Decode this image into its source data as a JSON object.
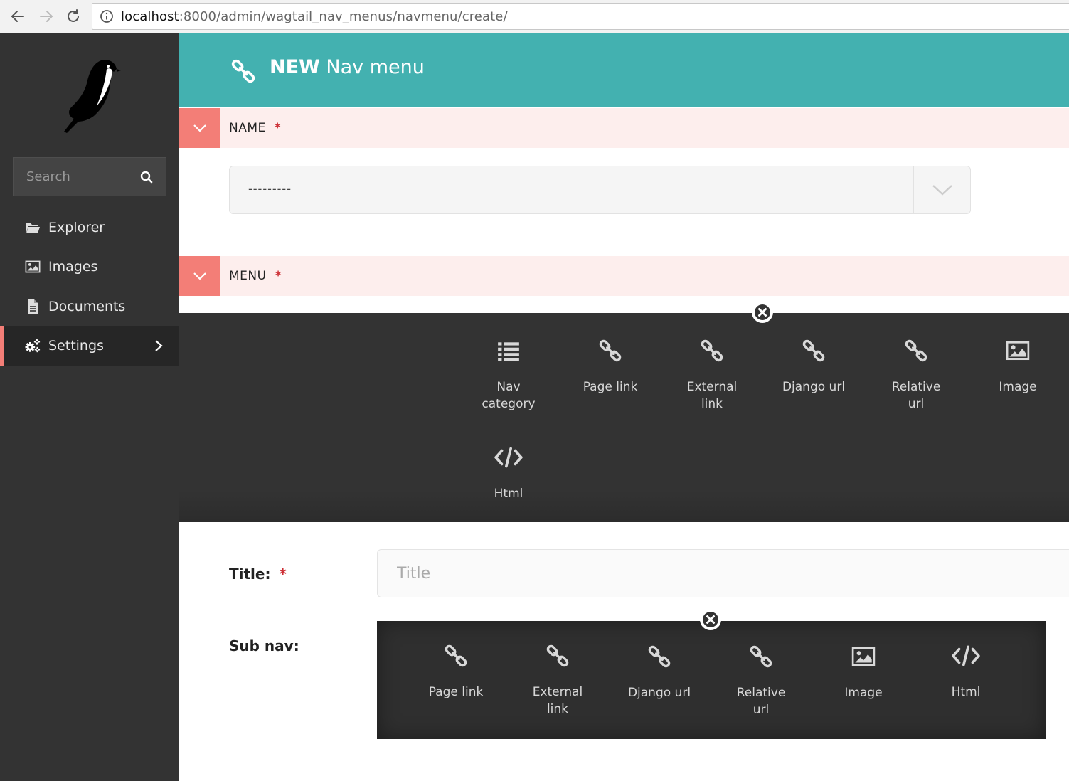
{
  "browser": {
    "url_host": "localhost",
    "url_path": ":8000/admin/wagtail_nav_menus/navmenu/create/"
  },
  "sidebar": {
    "search_placeholder": "Search",
    "items": [
      {
        "label": "Explorer",
        "icon": "folder-open-icon"
      },
      {
        "label": "Images",
        "icon": "image-icon"
      },
      {
        "label": "Documents",
        "icon": "document-icon"
      },
      {
        "label": "Settings",
        "icon": "cogs-icon",
        "active": true
      }
    ]
  },
  "header": {
    "title_bold": "NEW",
    "title_rest": "Nav menu",
    "icon": "link-icon"
  },
  "sections": {
    "name": {
      "label": "NAME",
      "required": "*"
    },
    "menu": {
      "label": "MENU",
      "required": "*"
    }
  },
  "name_select": {
    "value": "---------"
  },
  "menu_blocks": [
    {
      "line1": "Nav",
      "line2": "category",
      "icon": "list-icon"
    },
    {
      "line1": "Page link",
      "line2": "",
      "icon": "link-icon"
    },
    {
      "line1": "External",
      "line2": "link",
      "icon": "link-icon"
    },
    {
      "line1": "Django url",
      "line2": "",
      "icon": "link-icon"
    },
    {
      "line1": "Relative",
      "line2": "url",
      "icon": "link-icon"
    },
    {
      "line1": "Image",
      "line2": "",
      "icon": "image-icon"
    },
    {
      "line1": "Html",
      "line2": "",
      "icon": "code-icon"
    }
  ],
  "fields": {
    "title": {
      "label": "Title:",
      "required": "*",
      "placeholder": "Title"
    },
    "sub_nav": {
      "label": "Sub nav:"
    }
  },
  "subnav_blocks": [
    {
      "line1": "Page link",
      "line2": "",
      "icon": "link-icon"
    },
    {
      "line1": "External",
      "line2": "link",
      "icon": "link-icon"
    },
    {
      "line1": "Django url",
      "line2": "",
      "icon": "link-icon"
    },
    {
      "line1": "Relative",
      "line2": "url",
      "icon": "link-icon"
    },
    {
      "line1": "Image",
      "line2": "",
      "icon": "image-icon"
    },
    {
      "line1": "Html",
      "line2": "",
      "icon": "code-icon"
    }
  ],
  "colors": {
    "header": "#43b1b0",
    "accent": "#f37e77",
    "section_bg": "#fdeeed",
    "sidebar": "#333333",
    "required": "#cd2f35"
  }
}
